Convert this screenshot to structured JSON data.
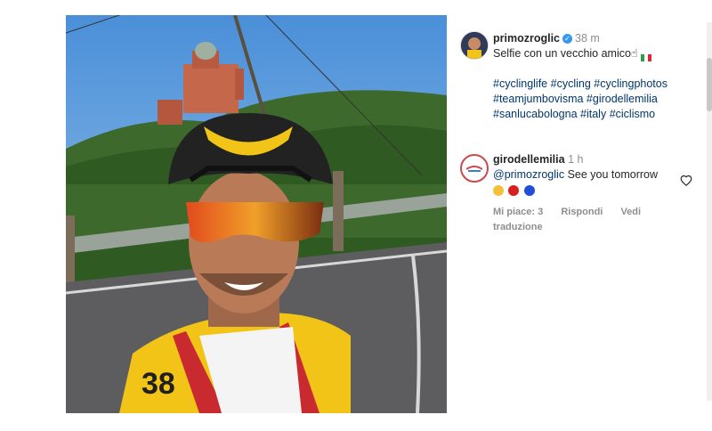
{
  "post": {
    "username": "primozroglic",
    "time": "38 m",
    "caption": "Selfie con un vecchio amico",
    "caption_emoji": "☝",
    "hashtags": [
      "#cyclinglife",
      "#cycling",
      "#cyclingphotos",
      "#teamjumbovisma",
      "#girodellemilia",
      "#sanlucabologna",
      "#italy",
      "#ciclismo"
    ]
  },
  "comment": {
    "username": "girodellemilia",
    "time": "1 h",
    "mention": "@primozroglic",
    "text": "See you tomorrow",
    "likes_label": "Mi piace: 3",
    "reply_label": "Rispondi",
    "translate_label": "Vedi traduzione"
  },
  "icons": {
    "verified": "verified-badge-icon",
    "heart": "heart-icon",
    "flag": "italy-flag-icon"
  },
  "colors": {
    "link": "#00376b",
    "verified": "#3897f0",
    "meta": "#8e8e8e"
  }
}
